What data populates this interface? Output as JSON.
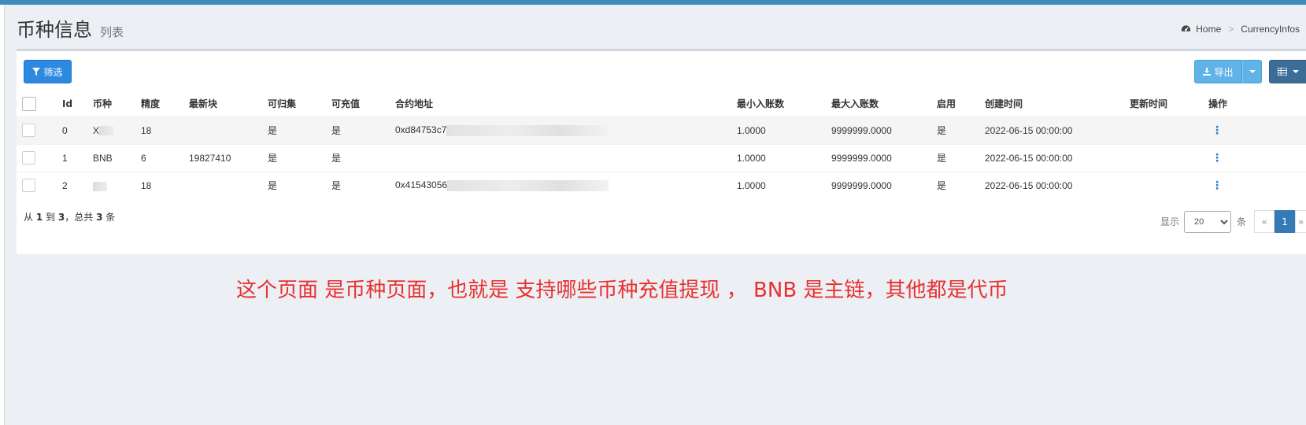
{
  "header": {
    "title": "币种信息",
    "subtitle": "列表"
  },
  "breadcrumb": {
    "home": "Home",
    "separator": ">",
    "current": "CurrencyInfos",
    "icon": "dashboard-icon"
  },
  "toolbar": {
    "filter_label": "筛选",
    "export_label": "导出",
    "columns_icon": "grid-icon"
  },
  "table": {
    "headers": [
      "Id",
      "币种",
      "精度",
      "最新块",
      "可归集",
      "可充值",
      "合约地址",
      "最小入账数",
      "最大入账数",
      "启用",
      "创建时间",
      "更新时间",
      "操作"
    ],
    "rows": [
      {
        "id": "0",
        "coin": "X",
        "precision": "18",
        "latest_block": "",
        "collectable": "是",
        "rechargeable": "是",
        "contract": "0xd84753c7",
        "min_in": "1.0000",
        "max_in": "9999999.0000",
        "enabled": "是",
        "created": "2022-06-15 00:00:00",
        "updated": ""
      },
      {
        "id": "1",
        "coin": "BNB",
        "precision": "6",
        "latest_block": "19827410",
        "collectable": "是",
        "rechargeable": "是",
        "contract": "",
        "min_in": "1.0000",
        "max_in": "9999999.0000",
        "enabled": "是",
        "created": "2022-06-15 00:00:00",
        "updated": ""
      },
      {
        "id": "2",
        "coin": "",
        "precision": "18",
        "latest_block": "",
        "collectable": "是",
        "rechargeable": "是",
        "contract": "0x41543056",
        "min_in": "1.0000",
        "max_in": "9999999.0000",
        "enabled": "是",
        "created": "2022-06-15 00:00:00",
        "updated": ""
      }
    ]
  },
  "summary": {
    "prefix": "从",
    "from": "1",
    "to_word": "到",
    "to": "3",
    "total_word": "，总共",
    "total": "3",
    "suffix": "条"
  },
  "pager": {
    "show_label": "显示",
    "page_size": "20",
    "unit": "条",
    "prev": "«",
    "current": "1",
    "next": "»"
  },
  "annotation": "这个页面 是币种页面，也就是 支持哪些币种充值提现 ， BNB 是主链，其他都是代币",
  "colors": {
    "brand": "#3c8dbc",
    "primary": "#2d8ae0",
    "annotation": "#e8302e"
  }
}
